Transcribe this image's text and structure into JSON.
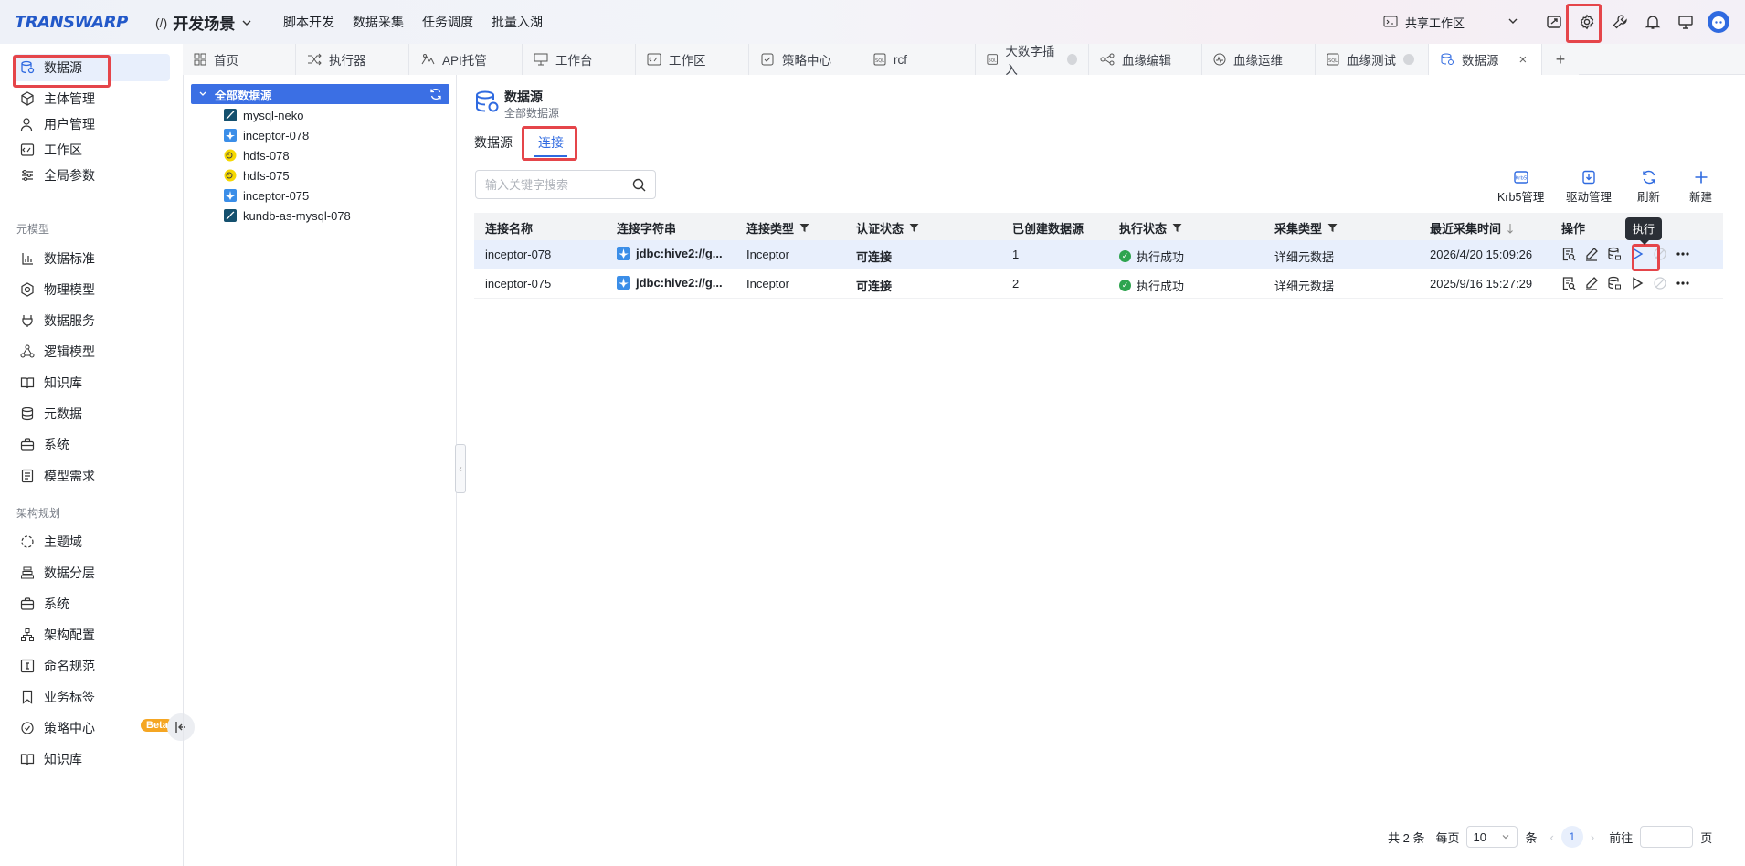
{
  "header": {
    "logo": "TRANSWARP",
    "scene_paren": "(/)",
    "scene": "开发场景",
    "nav": [
      "脚本开发",
      "数据采集",
      "任务调度",
      "批量入湖"
    ],
    "workspace": "共享工作区"
  },
  "tabs": [
    {
      "label": "首页",
      "icon": "grid-icon"
    },
    {
      "label": "执行器",
      "icon": "shuffle-icon"
    },
    {
      "label": "API托管",
      "icon": "api-icon"
    },
    {
      "label": "工作台",
      "icon": "monitor-icon"
    },
    {
      "label": "工作区",
      "icon": "code-icon"
    },
    {
      "label": "策略中心",
      "icon": "policy-icon"
    },
    {
      "label": "rcf",
      "icon": "sql-icon"
    },
    {
      "label": "大数字插入",
      "icon": "sql-icon"
    },
    {
      "label": "血缘编辑",
      "icon": "lineage-icon"
    },
    {
      "label": "血缘运维",
      "icon": "lineage-ops-icon"
    },
    {
      "label": "血缘测试",
      "icon": "sql-icon"
    },
    {
      "label": "数据源",
      "icon": "datasource-icon"
    }
  ],
  "sidebar": {
    "items_top": [
      {
        "label": "数据源",
        "icon": "datasource-icon"
      },
      {
        "label": "主体管理",
        "icon": "cube-icon"
      },
      {
        "label": "用户管理",
        "icon": "user-icon"
      },
      {
        "label": "工作区",
        "icon": "code-icon"
      },
      {
        "label": "全局参数",
        "icon": "sliders-icon"
      }
    ],
    "group1": "元模型",
    "items_meta": [
      {
        "label": "数据标准",
        "icon": "standard-icon"
      },
      {
        "label": "物理模型",
        "icon": "hexagon-icon"
      },
      {
        "label": "数据服务",
        "icon": "plug-icon"
      },
      {
        "label": "逻辑模型",
        "icon": "nodes-icon"
      },
      {
        "label": "知识库",
        "icon": "book-icon"
      },
      {
        "label": "元数据",
        "icon": "database-icon"
      },
      {
        "label": "系统",
        "icon": "briefcase-icon"
      },
      {
        "label": "模型需求",
        "icon": "document-icon"
      }
    ],
    "group2": "架构规划",
    "items_arch": [
      {
        "label": "主题域",
        "icon": "circle-icon"
      },
      {
        "label": "数据分层",
        "icon": "layers-icon"
      },
      {
        "label": "系统",
        "icon": "briefcase-icon"
      },
      {
        "label": "架构配置",
        "icon": "config-icon"
      },
      {
        "label": "命名规范",
        "icon": "naming-icon"
      },
      {
        "label": "业务标签",
        "icon": "bookmark-icon"
      },
      {
        "label": "策略中心",
        "icon": "policy-icon"
      },
      {
        "label": "知识库",
        "icon": "book-icon"
      }
    ],
    "beta": "Beta"
  },
  "tree": {
    "root": "全部数据源",
    "nodes": [
      {
        "label": "mysql-neko",
        "icon": "mysql-icon"
      },
      {
        "label": "inceptor-078",
        "icon": "inceptor-icon"
      },
      {
        "label": "hdfs-078",
        "icon": "hdfs-icon"
      },
      {
        "label": "hdfs-075",
        "icon": "hdfs-icon"
      },
      {
        "label": "inceptor-075",
        "icon": "inceptor-icon"
      },
      {
        "label": "kundb-as-mysql-078",
        "icon": "mysql-icon"
      }
    ]
  },
  "page": {
    "title": "数据源",
    "subtitle": "全部数据源",
    "subtabs": [
      "数据源",
      "连接"
    ],
    "search_placeholder": "输入关键字搜索",
    "tools": [
      "Krb5管理",
      "驱动管理",
      "刷新",
      "新建"
    ]
  },
  "table": {
    "headers": [
      "连接名称",
      "连接字符串",
      "连接类型",
      "认证状态",
      "已创建数据源",
      "执行状态",
      "采集类型",
      "最近采集时间",
      "操作"
    ],
    "rows": [
      {
        "name": "inceptor-078",
        "conn": "jdbc:hive2://g...",
        "type": "Inceptor",
        "auth": "可连接",
        "count": "1",
        "exec": "执行成功",
        "collect": "详细元数据",
        "time": "2026/4/20 15:09:26"
      },
      {
        "name": "inceptor-075",
        "conn": "jdbc:hive2://g...",
        "type": "Inceptor",
        "auth": "可连接",
        "count": "2",
        "exec": "执行成功",
        "collect": "详细元数据",
        "time": "2025/9/16 15:27:29"
      }
    ],
    "tooltip": "执行"
  },
  "pagination": {
    "total": "共 2 条",
    "per_page_label": "每页",
    "per_page": "10",
    "unit": "条",
    "current": "1",
    "goto": "前往",
    "page_unit": "页"
  },
  "colors": {
    "accent": "#2f6ae0",
    "highlight": "#e5454a",
    "success": "#2ea44f"
  }
}
